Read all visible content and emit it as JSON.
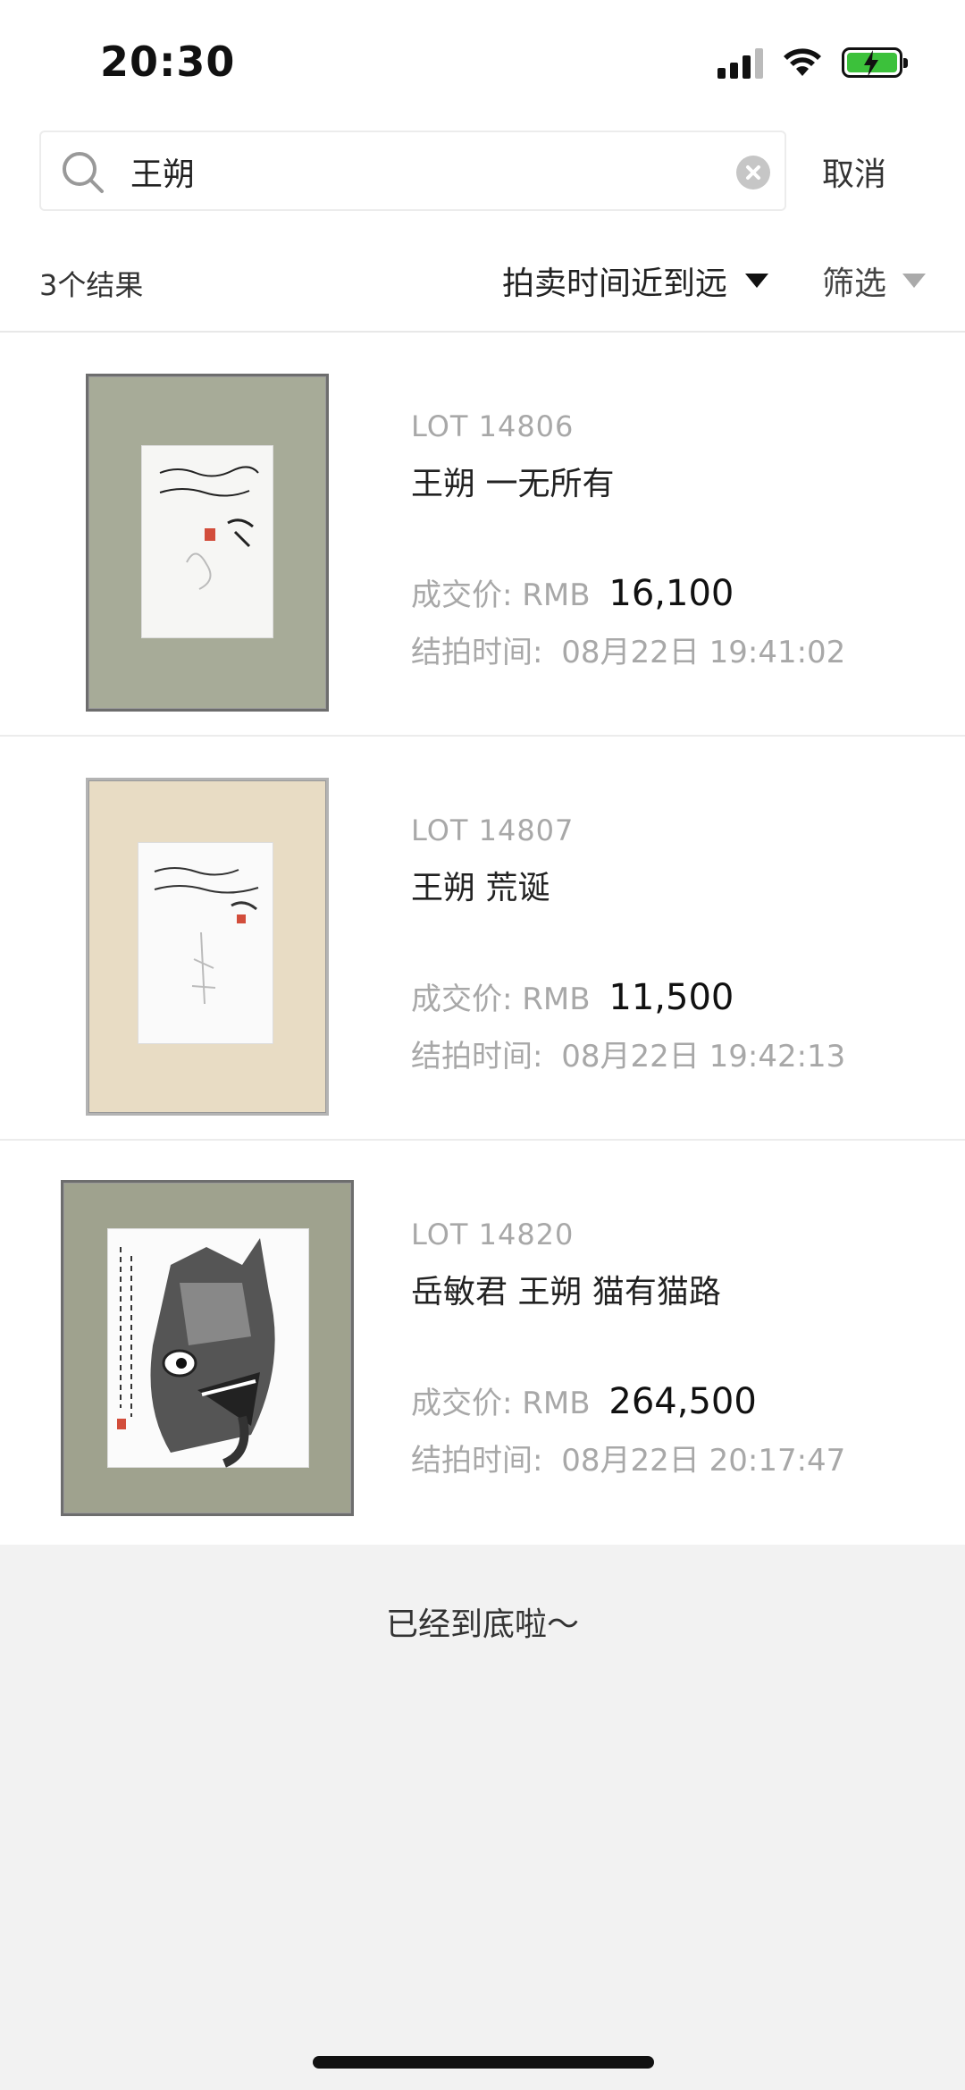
{
  "status_bar": {
    "time": "20:30"
  },
  "search": {
    "query": "王朔",
    "cancel_label": "取消"
  },
  "filter_bar": {
    "result_count": "3个结果",
    "sort_label": "拍卖时间近到远",
    "filter_label": "筛选"
  },
  "results": [
    {
      "lot": "LOT 14806",
      "title": "王朔  一无所有",
      "price_label": "成交价:",
      "currency": "RMB",
      "price": "16,100",
      "time_label": "结拍时间:",
      "time": "08月22日 19:41:02"
    },
    {
      "lot": "LOT 14807",
      "title": "王朔  荒诞",
      "price_label": "成交价:",
      "currency": "RMB",
      "price": "11,500",
      "time_label": "结拍时间:",
      "time": "08月22日 19:42:13"
    },
    {
      "lot": "LOT 14820",
      "title": "岳敏君 王朔  猫有猫路",
      "price_label": "成交价:",
      "currency": "RMB",
      "price": "264,500",
      "time_label": "结拍时间:",
      "time": "08月22日 20:17:47"
    }
  ],
  "footer": {
    "end_message": "已经到底啦～"
  },
  "colors": {
    "accent_battery": "#3cc13b",
    "muted_text": "#a8a8a8",
    "background": "#f2f2f2"
  }
}
